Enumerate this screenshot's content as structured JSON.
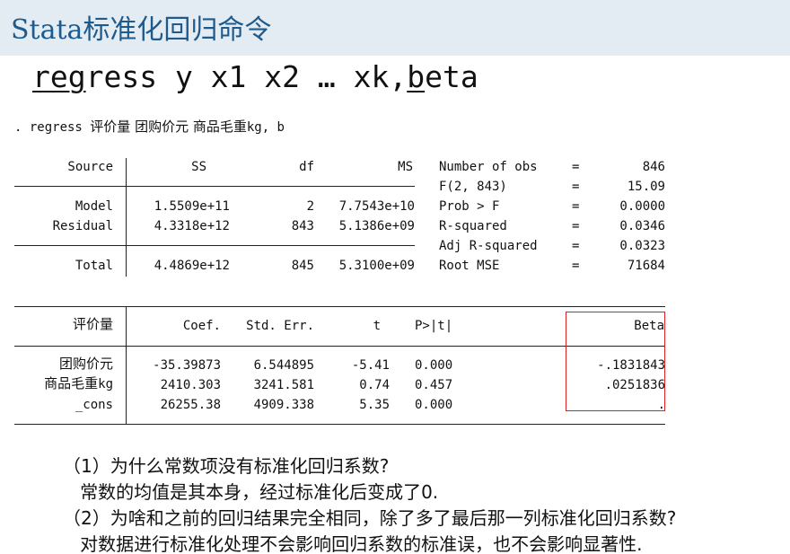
{
  "title": "Stata标准化回归命令",
  "command": {
    "p1": "reg",
    "p2": "ress y x1 x2 … xk,",
    "p3": "b",
    "p4": "eta"
  },
  "regress_line": {
    "prefix": ". regress ",
    "vars": "评价量 团购价元 商品毛重",
    "kg": "kg",
    "tail": ", b"
  },
  "anova": {
    "headers": {
      "source": "Source",
      "ss": "SS",
      "df": "df",
      "ms": "MS"
    },
    "rows": [
      {
        "source": "Model",
        "ss": "1.5509e+11",
        "df": "2",
        "ms": "7.7543e+10"
      },
      {
        "source": "Residual",
        "ss": "4.3318e+12",
        "df": "843",
        "ms": "5.1386e+09"
      },
      {
        "source": "Total",
        "ss": "4.4869e+12",
        "df": "845",
        "ms": "5.3100e+09"
      }
    ]
  },
  "stats": [
    {
      "label": "Number of obs",
      "eq": "=",
      "value": "846"
    },
    {
      "label": "F(2, 843)",
      "eq": "=",
      "value": "15.09"
    },
    {
      "label": "Prob > F",
      "eq": "=",
      "value": "0.0000"
    },
    {
      "label": "R-squared",
      "eq": "=",
      "value": "0.0346"
    },
    {
      "label": "Adj R-squared",
      "eq": "=",
      "value": "0.0323"
    },
    {
      "label": "Root MSE",
      "eq": "=",
      "value": "71684"
    }
  ],
  "coef_table": {
    "headers": {
      "var": "评价量",
      "coef": "Coef.",
      "se": "Std. Err.",
      "t": "t",
      "p": "P>|t|",
      "beta": "Beta"
    },
    "rows": [
      {
        "var": "团购价元",
        "var_suffix": "",
        "coef": "-35.39873",
        "se": "6.544895",
        "t": "-5.41",
        "p": "0.000",
        "beta": "-.1831843"
      },
      {
        "var": "商品毛重",
        "var_suffix": "kg",
        "coef": "2410.303",
        "se": "3241.581",
        "t": "0.74",
        "p": "0.457",
        "beta": ".0251836"
      },
      {
        "var": "_cons",
        "var_suffix": "",
        "coef": "26255.38",
        "se": "4909.338",
        "t": "5.35",
        "p": "0.000",
        "beta": "."
      }
    ]
  },
  "notes": [
    "（1）为什么常数项没有标准化回归系数?",
    "   常数的均值是其本身，经过标准化后变成了0.",
    "（2）为啥和之前的回归结果完全相同，除了多了最后那一列标准化回归系数?",
    "   对数据进行标准化处理不会影响回归系数的标准误，也不会影响显著性."
  ]
}
